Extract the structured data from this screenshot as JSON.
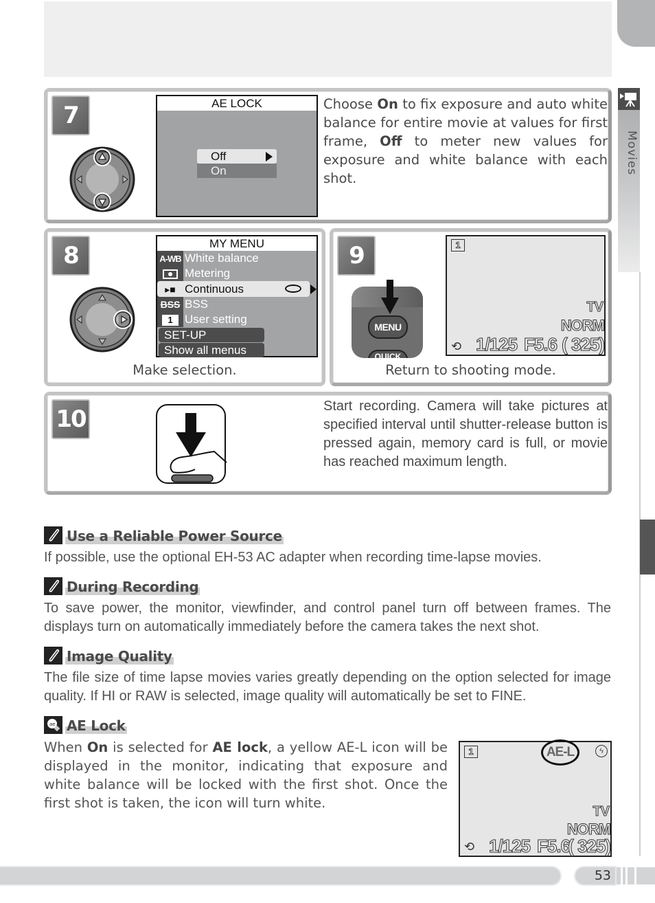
{
  "side_tab": {
    "label": "Movies",
    "icon": "movie-camera-icon"
  },
  "steps": {
    "s7": {
      "number": "7",
      "screen_title": "AE LOCK",
      "options": [
        {
          "label": "Off",
          "selected": true
        },
        {
          "label": "On",
          "selected": false
        }
      ],
      "dial_icon": "multi-selector-up-down-icon",
      "text_parts": [
        "Choose ",
        "On",
        " to fix exposure and auto white balance for entire movie at values for first frame, ",
        "Off",
        " to meter new values for exposure and white balance with each shot."
      ]
    },
    "s8": {
      "number": "8",
      "screen_title": "MY MENU",
      "items": [
        {
          "icon_text": "A-WB",
          "label": "White balance"
        },
        {
          "icon_text": "[•]",
          "label": "Metering"
        },
        {
          "icon_text": "▶■",
          "label": "Continuous",
          "selected": true
        },
        {
          "icon_text": "BSS",
          "label": "BSS"
        },
        {
          "icon_text": "1",
          "label": "User setting"
        }
      ],
      "footer_items": [
        "SET-UP",
        "Show all menus"
      ],
      "dial_icon": "multi-selector-right-icon",
      "caption": "Make selection."
    },
    "s9": {
      "number": "9",
      "button_label": "MENU",
      "button_below_label": "QUICK",
      "lcd": {
        "tl": "1",
        "tv": "TV",
        "norm": "NORM",
        "shutter": "1/125",
        "aperture": "F5.6",
        "frames": "( 325)"
      },
      "caption": "Return to shooting mode."
    },
    "s10": {
      "number": "10",
      "icon": "shutter-release-press-icon",
      "text": "Start recording.  Camera will take pictures at specified interval until shutter-release button is pressed again, memory card is full, or movie has reached maximum length."
    }
  },
  "notes": [
    {
      "icon": "pencil-note-icon",
      "title": "Use a Reliable Power Source",
      "body": "If possible, use the optional EH-53 AC adapter when recording time-lapse movies."
    },
    {
      "icon": "pencil-note-icon",
      "title": "During Recording",
      "body": "To save power, the monitor, viewfinder, and control panel turn off between frames.  The displays turn on automatically immediately before the camera takes the next shot."
    },
    {
      "icon": "pencil-note-icon",
      "title": "Image Quality",
      "body": "The file size of time lapse movies varies greatly depending on the option selected for image quality.  If HI or RAW is selected, image quality will automatically be set to FINE."
    },
    {
      "icon": "magnifier-tip-icon",
      "title": "AE Lock",
      "body_parts": [
        "When ",
        "On",
        " is selected for ",
        "AE lock",
        ", a yellow AE-L icon will be displayed in the monitor, indicating that exposure and white balance will be locked with the first shot.  Once the first shot is taken, the icon will turn white."
      ]
    }
  ],
  "ae_lcd": {
    "tl": "1",
    "ael": "AE-L",
    "tv": "TV",
    "norm": "NORM",
    "shutter": "1/125",
    "aperture": "F5.6",
    "frames": "( 325)"
  },
  "footer": {
    "page_number": "53"
  }
}
